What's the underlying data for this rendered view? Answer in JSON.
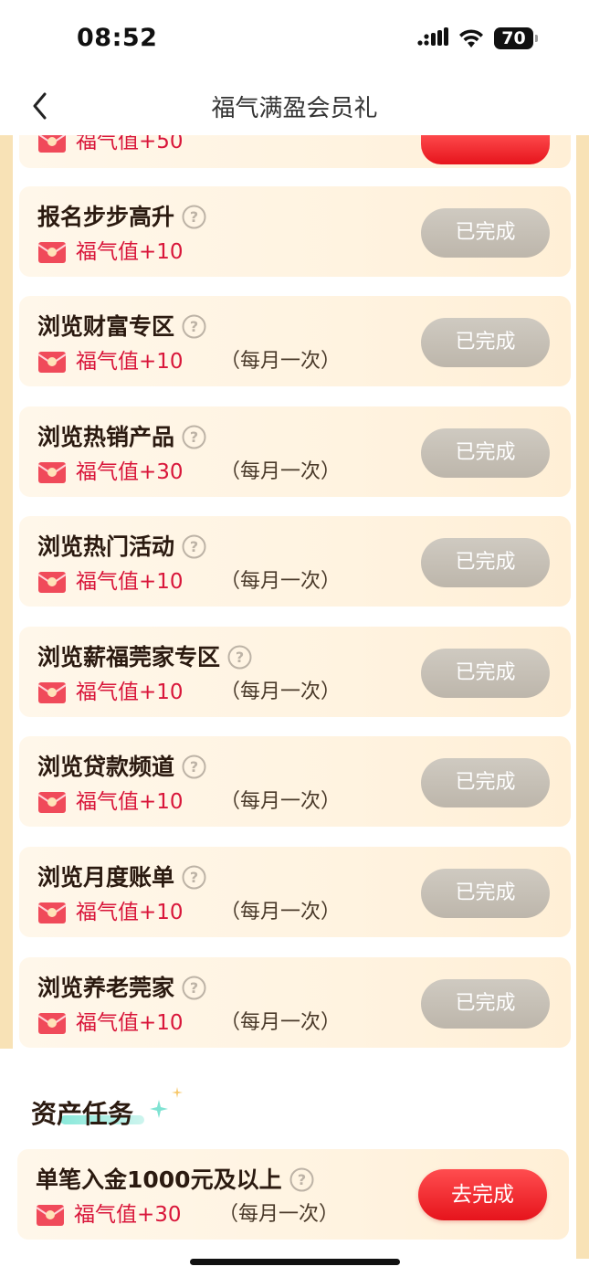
{
  "status_bar": {
    "time": "08:52",
    "battery": "70"
  },
  "nav": {
    "title": "福气满盈会员礼"
  },
  "top_partial": {
    "reward": "福气值+50"
  },
  "tasks": [
    {
      "name": "报名步步高升",
      "reward": "福气值+10",
      "freq": "",
      "button": "已完成"
    },
    {
      "name": "浏览财富专区",
      "reward": "福气值+10",
      "freq": "（每月一次）",
      "button": "已完成"
    },
    {
      "name": "浏览热销产品",
      "reward": "福气值+30",
      "freq": "（每月一次）",
      "button": "已完成"
    },
    {
      "name": "浏览热门活动",
      "reward": "福气值+10",
      "freq": "（每月一次）",
      "button": "已完成"
    },
    {
      "name": "浏览薪福莞家专区",
      "reward": "福气值+10",
      "freq": "（每月一次）",
      "button": "已完成"
    },
    {
      "name": "浏览贷款频道",
      "reward": "福气值+10",
      "freq": "（每月一次）",
      "button": "已完成"
    },
    {
      "name": "浏览月度账单",
      "reward": "福气值+10",
      "freq": "（每月一次）",
      "button": "已完成"
    },
    {
      "name": "浏览养老莞家",
      "reward": "福气值+10",
      "freq": "（每月一次）",
      "button": "已完成"
    }
  ],
  "asset_section": {
    "title": "资产任务",
    "task": {
      "name": "单笔入金1000元及以上",
      "reward": "福气值+30",
      "freq": "（每月一次）",
      "button": "去完成"
    }
  }
}
